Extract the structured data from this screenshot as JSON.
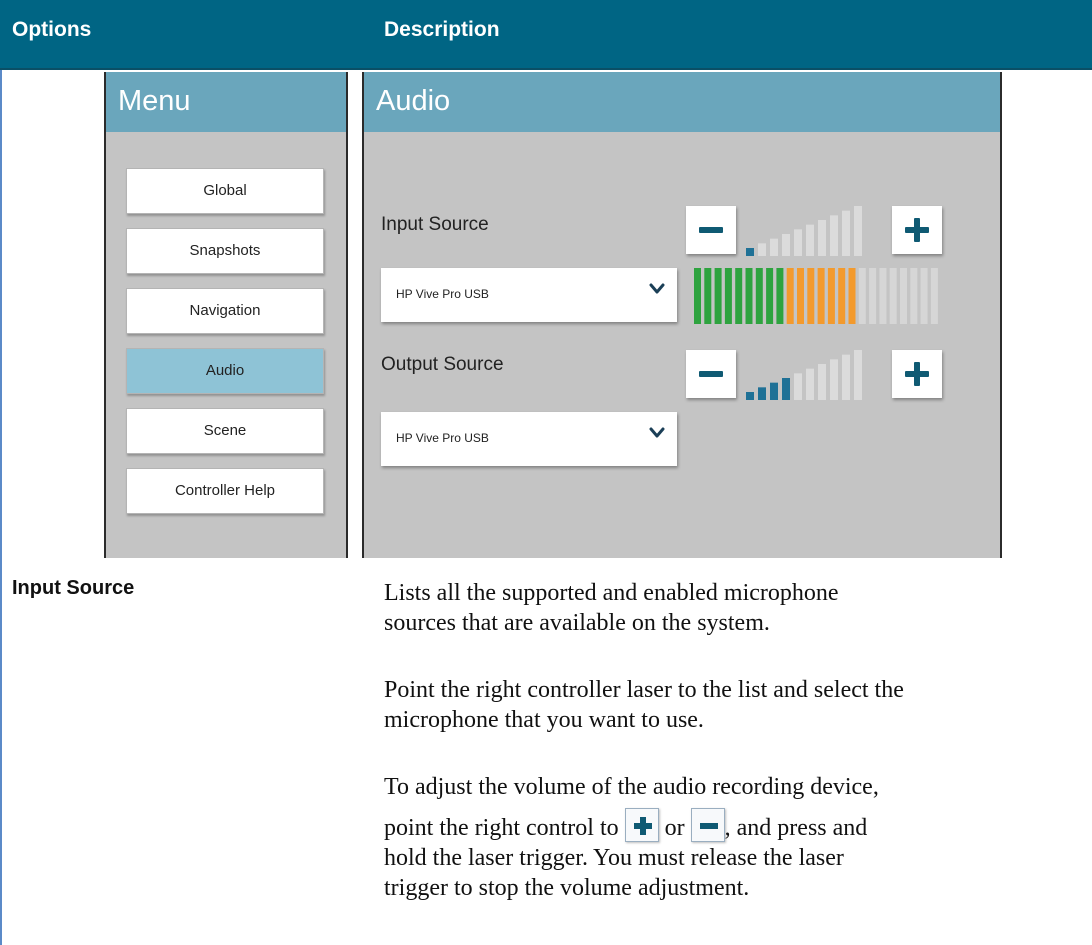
{
  "table": {
    "header": {
      "options": "Options",
      "description": "Description"
    },
    "row": {
      "option": "Input Source",
      "paragraphs": {
        "p1_line1": "Lists all the supported and enabled microphone",
        "p1_line2": "sources that are available on the system.",
        "p2_line1": "Point the right controller laser to the list and select the",
        "p2_line2": "microphone that you want to use.",
        "p3_line1": "To adjust the volume of the audio recording device,",
        "p3_line2_a": "point the right control to",
        "p3_line2_b": "or",
        "p3_line2_c": ", and press and",
        "p3_line3": "hold the laser trigger. You must release the laser",
        "p3_line4": "trigger to stop the volume adjustment."
      }
    }
  },
  "menu": {
    "title": "Menu",
    "items": [
      {
        "label": "Global",
        "active": false
      },
      {
        "label": "Snapshots",
        "active": false
      },
      {
        "label": "Navigation",
        "active": false
      },
      {
        "label": "Audio",
        "active": true
      },
      {
        "label": "Scene",
        "active": false
      },
      {
        "label": "Controller Help",
        "active": false
      }
    ]
  },
  "audio": {
    "title": "Audio",
    "input": {
      "label": "Input Source",
      "selected": "HP Vive Pro USB",
      "volume_level": 1,
      "volume_steps": 10,
      "meter": {
        "green": 9,
        "orange": 7,
        "empty": 8
      }
    },
    "output": {
      "label": "Output Source",
      "selected": "HP Vive Pro USB",
      "volume_level": 4,
      "volume_steps": 10
    }
  },
  "colors": {
    "header_bg": "#006584",
    "panel_head": "#6aa6bc",
    "panel_bg": "#c4c4c4",
    "active_item": "#8ec3d6",
    "volume_active": "#1f7196",
    "volume_inactive": "#dbdbdb",
    "meter_green": "#2ea33f",
    "meter_orange": "#f39a2d",
    "meter_empty": "#d6d6d6",
    "icon_teal": "#0f5a73"
  }
}
